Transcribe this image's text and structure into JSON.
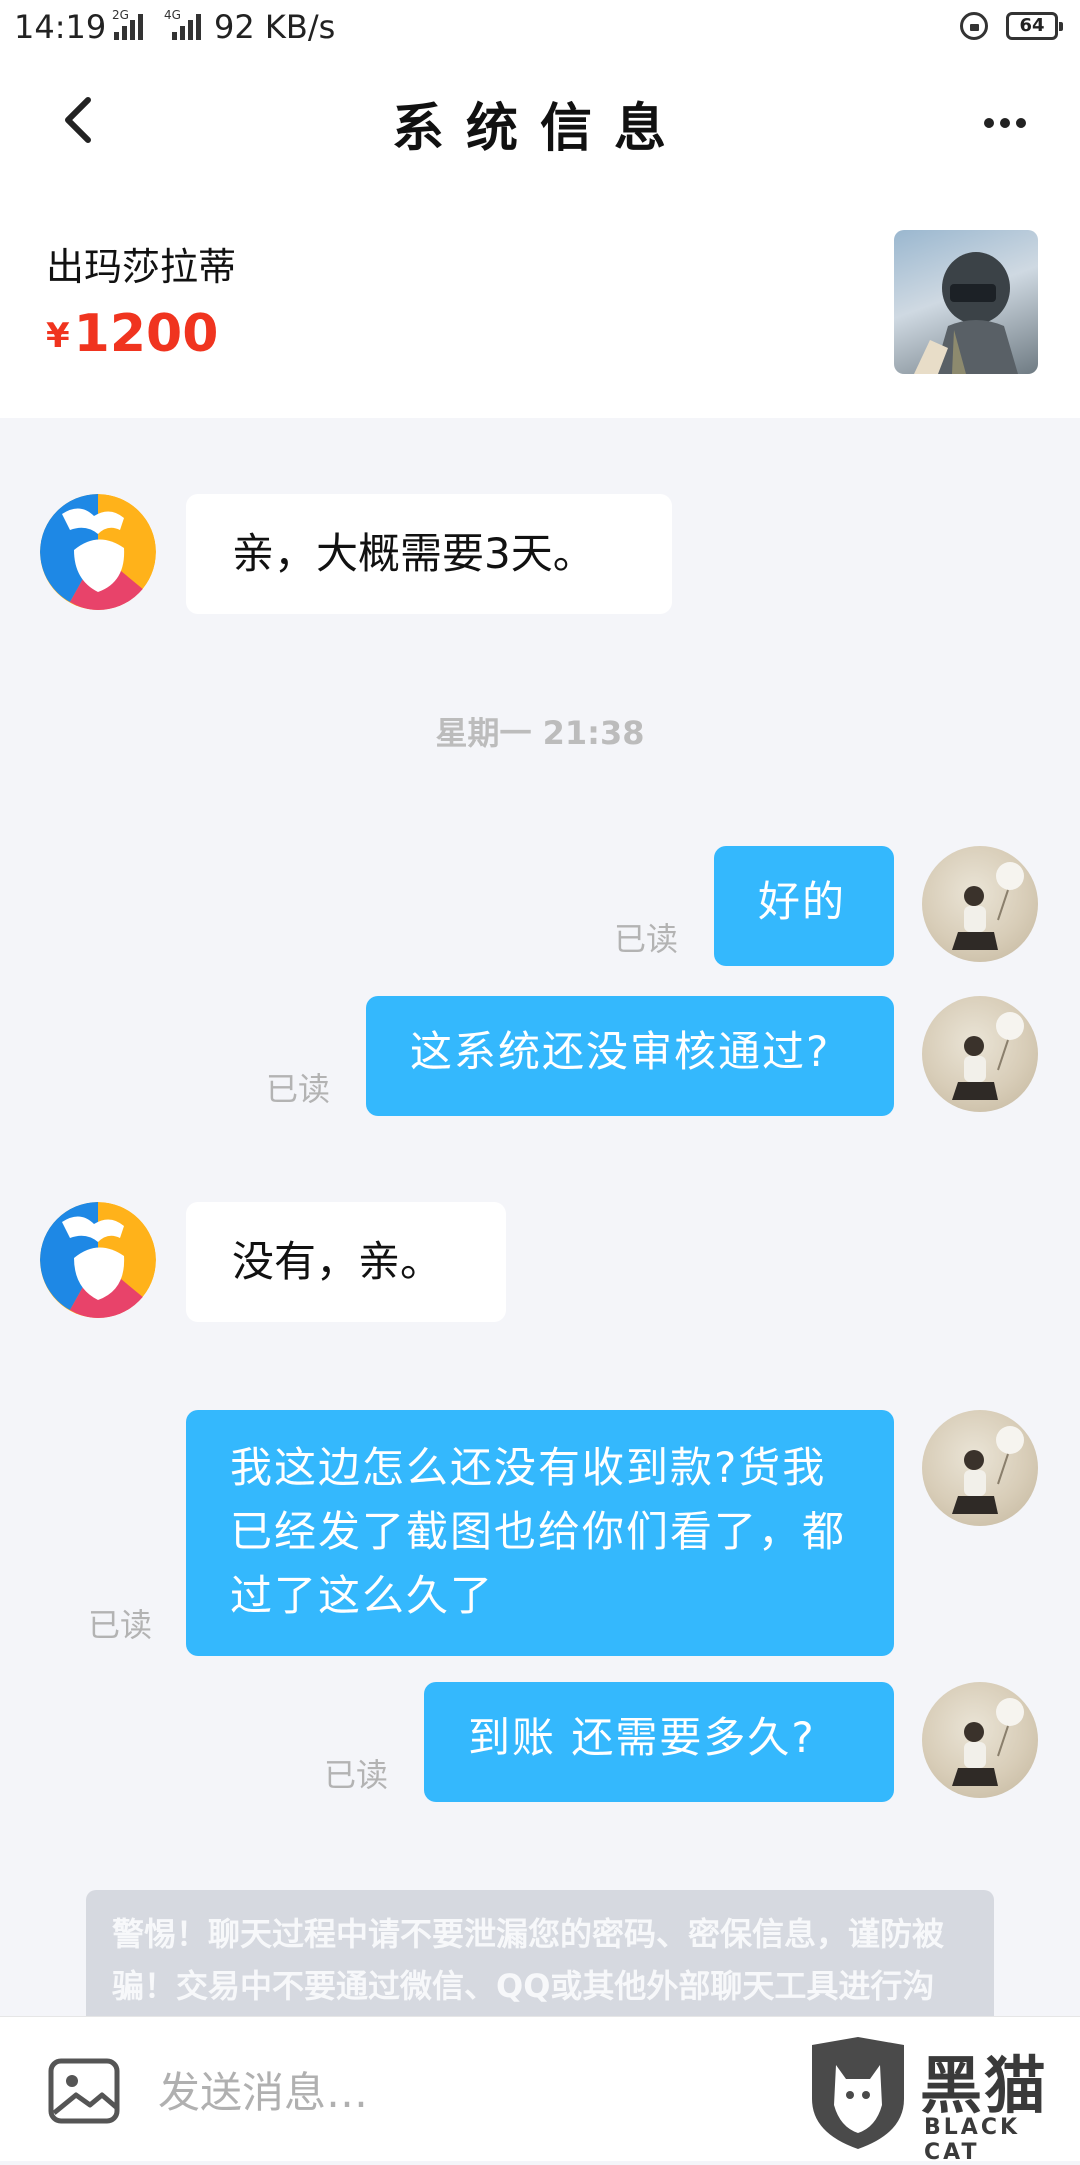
{
  "status_bar": {
    "time": "14:19",
    "signal_1_tag": "2G",
    "signal_2_tag": "4G",
    "network_speed": "92 KB/s",
    "battery": "64"
  },
  "header": {
    "title": "系统信息",
    "back_icon": "chevron-left-icon",
    "more_icon": "more-dots-icon"
  },
  "item": {
    "name": "出玛莎拉蒂",
    "currency": "¥",
    "price": "1200",
    "thumbnail": "game-character-helmet-image"
  },
  "messages": [
    {
      "side": "in",
      "text": "亲，大概需要3天。"
    },
    {
      "side": "out",
      "text": "好的",
      "status": "已读"
    },
    {
      "side": "out",
      "text": "这系统还没审核通过?",
      "status": "已读"
    },
    {
      "side": "in",
      "text": "没有，亲。"
    },
    {
      "side": "out",
      "text": "我这边怎么还没有收到款?货我已经发了截图也给你们看了，都过了这么久了",
      "status": "已读"
    },
    {
      "side": "out",
      "text": "到账 还需要多久?",
      "status": "已读"
    }
  ],
  "timestamp": "星期一 21:38",
  "warning": "警惕！聊天过程中请不要泄漏您的密码、密保信息，谨防被骗！交易中不要通过微信、QQ或其他外部聊天工具进行沟通，否则后果自负！",
  "input": {
    "placeholder": "发送消息…",
    "image_icon": "image-picker-icon"
  },
  "watermark": {
    "text": "黑猫",
    "subtext": "BLACK CAT"
  },
  "colors": {
    "outgoing_bubble": "#34b8fd",
    "price": "#f0341f",
    "background": "#f4f5f9"
  }
}
